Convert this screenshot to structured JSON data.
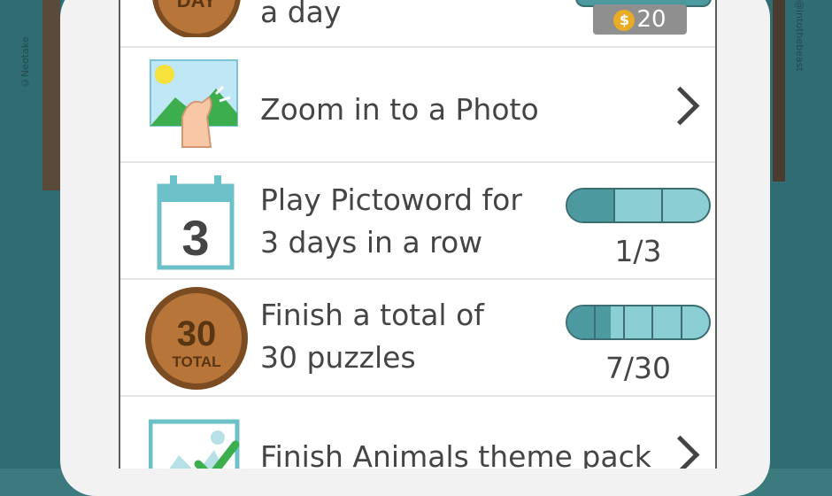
{
  "credits": {
    "left": "©Neotake",
    "right": "@intothebeast"
  },
  "rows": [
    {
      "label": "a day",
      "badge_text": "DAY",
      "reward_amount": "20",
      "coin_symbol": "$"
    },
    {
      "label": "Zoom in to a Photo"
    },
    {
      "label_line1": "Play Pictoword for",
      "label_line2": "3 days in a row",
      "calendar_number": "3",
      "progress": "1/3"
    },
    {
      "label_line1": "Finish a total of",
      "label_line2": "30 puzzles",
      "badge_number": "30",
      "badge_text": "TOTAL",
      "progress": "7/30"
    },
    {
      "label": "Finish Animals theme pack"
    }
  ]
}
